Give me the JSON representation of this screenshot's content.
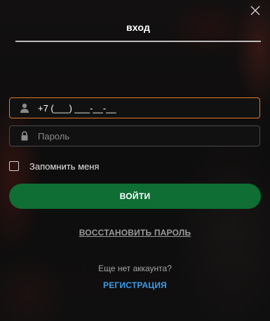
{
  "dialog": {
    "tab_label": "вход",
    "close_icon": "close-icon"
  },
  "form": {
    "phone": {
      "value": "+7 (___) ___-__-__",
      "icon": "user-icon"
    },
    "password": {
      "placeholder": "Пароль",
      "icon": "lock-icon"
    },
    "remember_label": "Запомнить меня",
    "remember_checked": false,
    "login_button": "ВОЙТИ",
    "restore_link": "ВОССТАНОВИТЬ ПАРОЛЬ"
  },
  "footer": {
    "no_account_text": "Еще нет аккаунта?",
    "register_link": "РЕГИСТРАЦИЯ"
  },
  "colors": {
    "accent_green": "#0e6e34",
    "focus_border": "#e07a2e",
    "link_blue": "#3d9be9"
  }
}
